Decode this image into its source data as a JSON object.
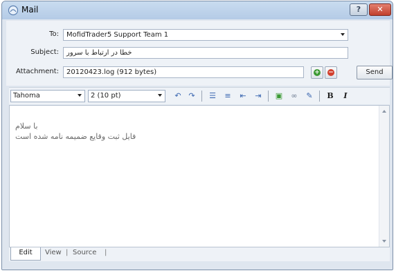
{
  "window": {
    "title": "Mail",
    "title_icon": "mail-icon",
    "help_label": "?",
    "close_label": "✕"
  },
  "form": {
    "to_label": "To:",
    "to_value": "MofidTrader5 Support Team 1",
    "subject_label": "Subject:",
    "subject_value": "خطا در ارتباط با سرور",
    "attachment_label": "Attachment:",
    "attachment_value": "20120423.log (912 bytes)",
    "add_attachment_icon": "plus-icon",
    "remove_attachment_icon": "remove-icon",
    "send_label": "Send"
  },
  "toolbar": {
    "font_value": "Tahoma",
    "size_value": "2 (10 pt)",
    "bold_label": "B",
    "italic_label": "I"
  },
  "editor": {
    "line1": "با سلام",
    "line2": "فایل ثبت وقایع ضمیمه نامه شده است"
  },
  "tabs": {
    "edit": "Edit",
    "view": "View",
    "source": "Source",
    "sep": "|"
  },
  "colors": {
    "titlebar": "#c9dcf0",
    "close": "#c1402d",
    "add": "#3c9a34",
    "remove": "#d2402e"
  }
}
